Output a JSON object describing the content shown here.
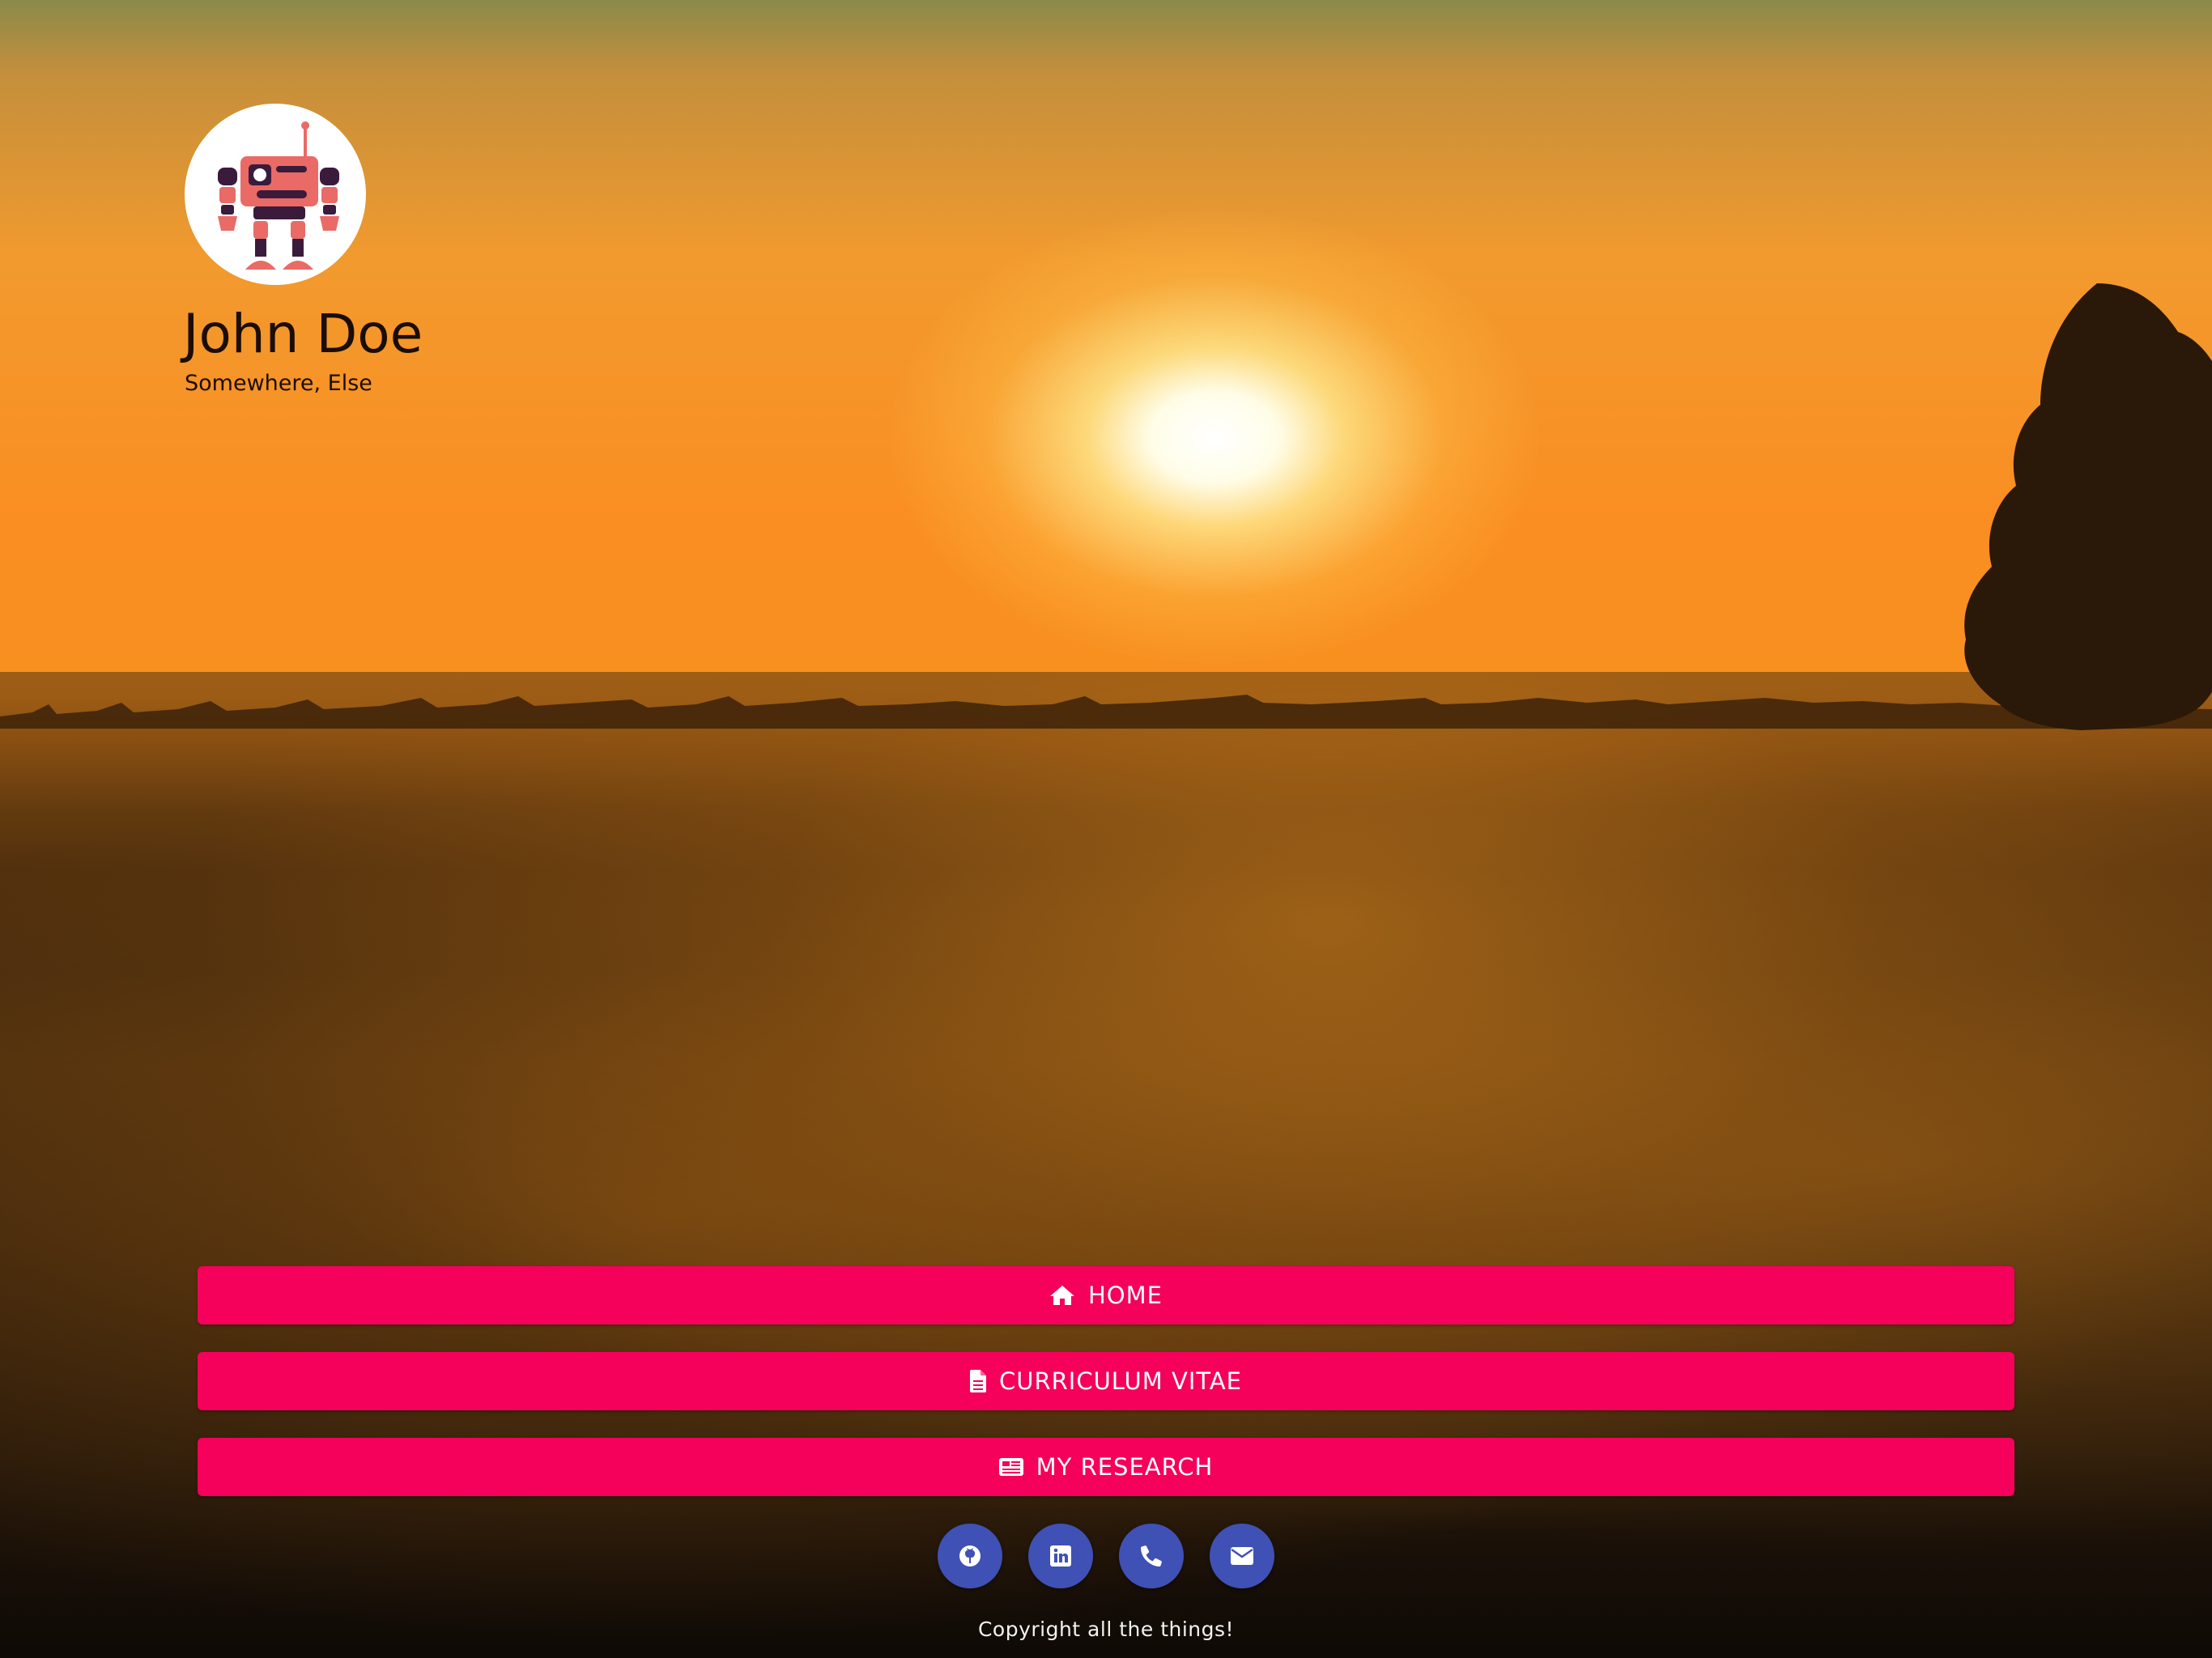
{
  "profile": {
    "name": "John Doe",
    "location": "Somewhere, Else",
    "avatar_icon": "robot-avatar"
  },
  "nav": {
    "items": [
      {
        "label": "HOME",
        "icon": "home-icon"
      },
      {
        "label": "CURRICULUM VITAE",
        "icon": "file-icon"
      },
      {
        "label": "MY RESEARCH",
        "icon": "newspaper-icon"
      }
    ]
  },
  "social": {
    "items": [
      {
        "icon": "github-icon"
      },
      {
        "icon": "linkedin-icon"
      },
      {
        "icon": "phone-icon"
      },
      {
        "icon": "envelope-icon"
      }
    ]
  },
  "footer": {
    "copyright": "Copyright all the things!"
  },
  "colors": {
    "button": "#f5005a",
    "social": "#3f51b5",
    "text_dark": "#1b0d05",
    "footer_text": "#f2f2f2"
  }
}
